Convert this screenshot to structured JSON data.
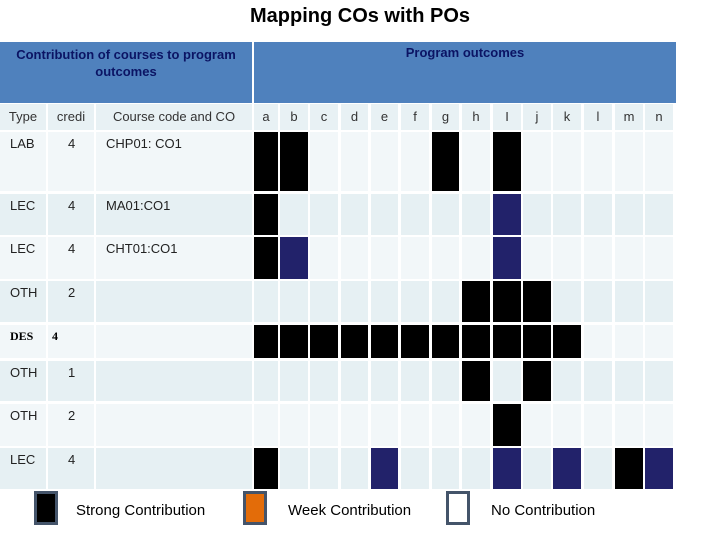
{
  "title": "Mapping COs with POs",
  "header": {
    "left": "Contribution of courses to program outcomes",
    "right": "Program outcomes"
  },
  "columns": {
    "type": "Type",
    "credit": "credi",
    "course": "Course code and CO",
    "outcomes": [
      "a",
      "b",
      "c",
      "d",
      "e",
      "f",
      "g",
      "h",
      "I",
      "j",
      "k",
      "l",
      "m",
      "n"
    ]
  },
  "colors": {
    "header": "#4f81bd",
    "strong": "#000000",
    "week": "#22226a",
    "legend_week": "#e36c09"
  },
  "rows": [
    {
      "type": "LAB",
      "credit": "4",
      "course": "CHP01: CO1",
      "marks": [
        "S",
        "S",
        "",
        "",
        "",
        "",
        "S",
        "",
        "S",
        "",
        "",
        "",
        "",
        ""
      ]
    },
    {
      "type": "LEC",
      "credit": "4",
      "course": "MA01:CO1",
      "marks": [
        "S",
        "",
        "",
        "",
        "",
        "",
        "",
        "",
        "W",
        "",
        "",
        "",
        "",
        ""
      ]
    },
    {
      "type": "LEC",
      "credit": "4",
      "course": "CHT01:CO1",
      "marks": [
        "S",
        "W",
        "",
        "",
        "",
        "",
        "",
        "",
        "W",
        "",
        "",
        "",
        "",
        ""
      ]
    },
    {
      "type": "OTH",
      "credit": "2",
      "course": "",
      "marks": [
        "",
        "",
        "",
        "",
        "",
        "",
        "",
        "S",
        "S",
        "S",
        "",
        "",
        "",
        ""
      ]
    },
    {
      "type": "DES",
      "credit": "4",
      "course": "",
      "marks": [
        "S",
        "S",
        "S",
        "S",
        "S",
        "S",
        "S",
        "S",
        "S",
        "S",
        "S",
        "",
        "",
        ""
      ]
    },
    {
      "type": "OTH",
      "credit": "1",
      "course": "",
      "marks": [
        "",
        "",
        "",
        "",
        "",
        "",
        "",
        "S",
        "",
        "S",
        "",
        "",
        "",
        ""
      ]
    },
    {
      "type": "OTH",
      "credit": "2",
      "course": "",
      "marks": [
        "",
        "",
        "",
        "",
        "",
        "",
        "",
        "",
        "S",
        "",
        "",
        "",
        "",
        ""
      ]
    },
    {
      "type": "LEC",
      "credit": "4",
      "course": "",
      "marks": [
        "S",
        "",
        "",
        "",
        "W",
        "",
        "",
        "",
        "W",
        "",
        "W",
        "",
        "S",
        "W"
      ]
    }
  ],
  "legend": [
    {
      "label": "Strong Contribution",
      "swatch": "strong"
    },
    {
      "label": "Week Contribution",
      "swatch": "week"
    },
    {
      "label": "No Contribution",
      "swatch": "none"
    }
  ]
}
